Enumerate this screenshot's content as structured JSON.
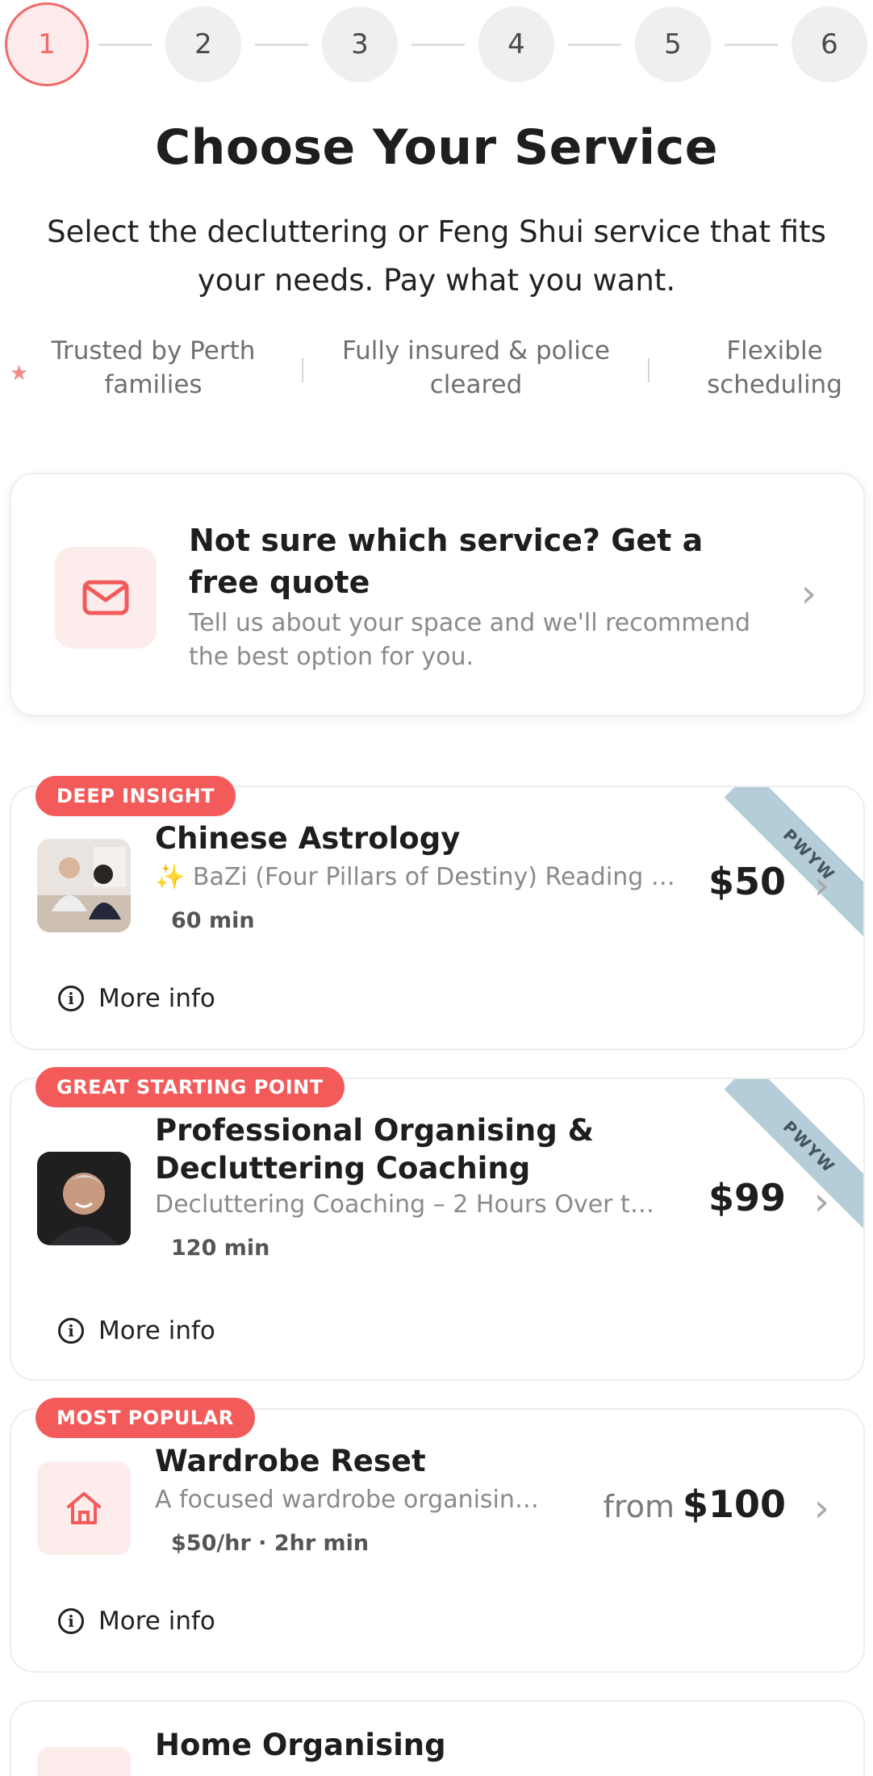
{
  "stepper": {
    "steps": [
      "1",
      "2",
      "3",
      "4",
      "5",
      "6"
    ],
    "active": 1
  },
  "header": {
    "title": "Choose Your Service",
    "subtitle": "Select the decluttering or Feng Shui service that fits your needs. Pay what you want."
  },
  "trust": [
    "Trusted by Perth families",
    "Fully insured & police cleared",
    "Flexible scheduling"
  ],
  "quote_card": {
    "title": "Not sure which service? Get a free quote",
    "description": "Tell us about your space and we'll recommend the best option for you.",
    "icon": "mail-icon"
  },
  "services": [
    {
      "badge": "DEEP INSIGHT",
      "title": "Chinese Astrology",
      "description": "✨ BaZi (Four Pillars of Destiny) Reading ✨ ...",
      "duration": "60 min",
      "price": "$50",
      "price_prefix": "",
      "ribbon": "PWYW",
      "more_info": "More info"
    },
    {
      "badge": "GREAT STARTING POINT",
      "title": "Professional Organising & Decluttering Coaching",
      "description": "Decluttering Coaching – 2 Hours Over the...",
      "duration": "120 min",
      "price": "$99",
      "price_prefix": "",
      "ribbon": "PWYW",
      "more_info": "More info"
    },
    {
      "badge": "MOST POPULAR",
      "title": "Wardrobe Reset",
      "description": "A focused wardrobe organising...",
      "duration": "$50/hr · 2hr min",
      "price": "$100",
      "price_prefix": "from",
      "ribbon": "",
      "more_info": "More info"
    },
    {
      "badge": "",
      "title": "Home Organising",
      "description": "",
      "duration": "",
      "price": "",
      "price_prefix": "",
      "ribbon": "",
      "more_info": ""
    }
  ],
  "colors": {
    "accent": "#f35b5b",
    "accent_light": "#fdecec",
    "ribbon": "#b5cdd8"
  }
}
